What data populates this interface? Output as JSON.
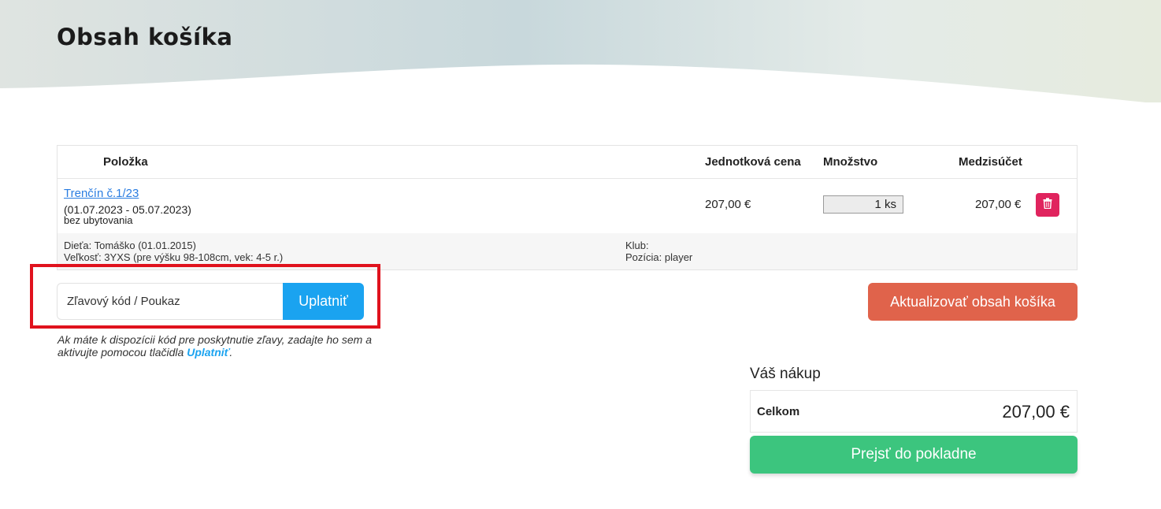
{
  "page": {
    "title": "Obsah košíka"
  },
  "table": {
    "headers": {
      "item": "Položka",
      "unit_price": "Jednotková cena",
      "quantity": "Množstvo",
      "subtotal": "Medzisúčet"
    },
    "rows": [
      {
        "name": "Trenčín č.1/23",
        "dates": "(01.07.2023 - 05.07.2023)",
        "accommodation": "bez ubytovania",
        "unit_price": "207,00 €",
        "quantity": "1 ks",
        "subtotal": "207,00 €",
        "details": {
          "child": "Dieťa: Tomáško (01.01.2015)",
          "size": "Veľkosť: 3YXS (pre výšku 98-108cm, vek: 4-5 r.)",
          "club": "Klub:",
          "position": "Pozícia: player"
        }
      }
    ]
  },
  "coupon": {
    "placeholder": "Zľavový kód / Poukaz",
    "apply_label": "Uplatniť",
    "hint_before": "Ak máte k dispozícii kód pre poskytnutie zľavy, zadajte ho sem a aktivujte pomocou tlačidla ",
    "hint_link": "Uplatniť",
    "hint_after": "."
  },
  "update_cart_label": "Aktualizovať obsah košíka",
  "summary": {
    "title": "Váš nákup",
    "total_label": "Celkom",
    "total_value": "207,00 €",
    "checkout_label": "Prejsť do pokladne"
  },
  "icons": {
    "delete": "trash-icon"
  },
  "colors": {
    "apply_button": "#1aa3f0",
    "update_button": "#e0634b",
    "checkout_button": "#3cc57e",
    "delete_button": "#e0245e",
    "highlight_frame": "#e0121d"
  }
}
